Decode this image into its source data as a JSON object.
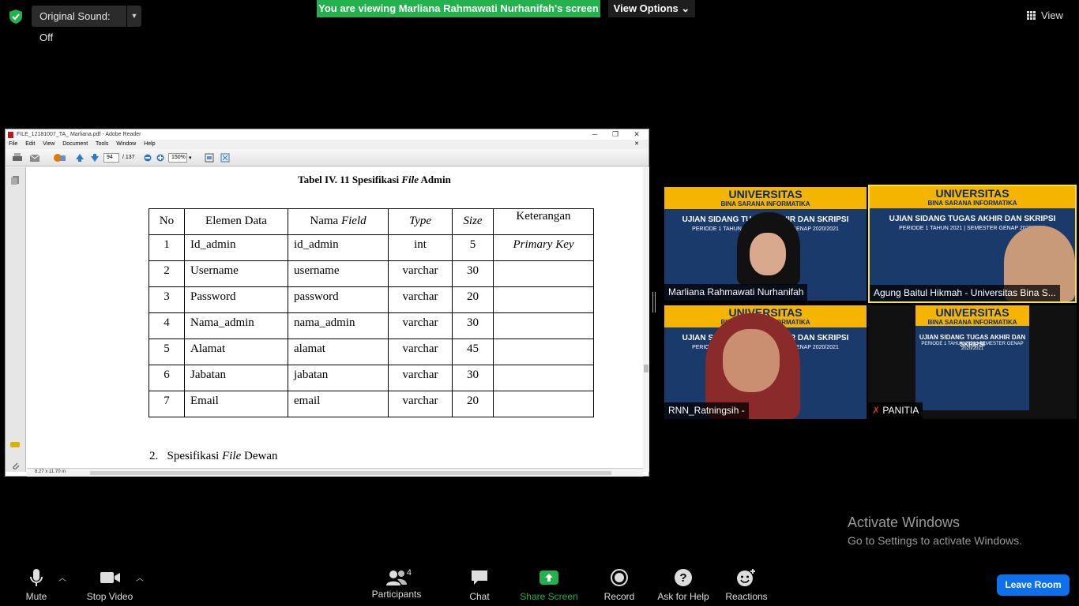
{
  "topbar": {
    "sound_label": "Original Sound: Off",
    "viewing_banner": "You are viewing Marliana Rahmawati Nurhanifah's screen",
    "view_options_label": "View Options",
    "view_label": "View"
  },
  "reader": {
    "window_title": "FILE_12181007_TA_ Marliana.pdf - Adobe Reader",
    "menu": [
      "File",
      "Edit",
      "View",
      "Document",
      "Tools",
      "Window",
      "Help"
    ],
    "page_current": "94",
    "page_total": "/ 137",
    "zoom": "150%",
    "page_size": "8.27 x 11.70 in",
    "table_title_prefix": "Tabel IV. 11 Spesifikasi ",
    "table_title_em": "File",
    "table_title_suffix": " Admin",
    "headers": {
      "no": "No",
      "elemen": "Elemen Data",
      "nama_prefix": "Nama ",
      "nama_em": "Field",
      "type": "Type",
      "size": "Size",
      "keterangan": "Keterangan"
    },
    "rows": [
      {
        "no": "1",
        "elemen": "Id_admin",
        "field": "id_admin",
        "type": "int",
        "size": "5",
        "ket": "Primary Key"
      },
      {
        "no": "2",
        "elemen": "Username",
        "field": "username",
        "type": "varchar",
        "size": "30",
        "ket": ""
      },
      {
        "no": "3",
        "elemen": "Password",
        "field": "password",
        "type": "varchar",
        "size": "20",
        "ket": ""
      },
      {
        "no": "4",
        "elemen": "Nama_admin",
        "field": "nama_admin",
        "type": "varchar",
        "size": "30",
        "ket": ""
      },
      {
        "no": "5",
        "elemen": "Alamat",
        "field": "alamat",
        "type": "varchar",
        "size": "45",
        "ket": ""
      },
      {
        "no": "6",
        "elemen": "Jabatan",
        "field": "jabatan",
        "type": "varchar",
        "size": "30",
        "ket": ""
      },
      {
        "no": "7",
        "elemen": "Email",
        "field": "email",
        "type": "varchar",
        "size": "20",
        "ket": ""
      }
    ],
    "section_number": "2.",
    "section_prefix": "Spesifikasi ",
    "section_em": "File",
    "section_suffix": " Dewan"
  },
  "videos": {
    "banner_title": "UNIVERSITAS",
    "banner_subtitle": "BINA SARANA INFORMATIKA",
    "event_title": "UJIAN SIDANG TUGAS AKHIR DAN SKRIPSI",
    "event_period": "PERIODE 1 TAHUN 2021 | SEMESTER GENAP 2020/2021",
    "participants": [
      {
        "name": "Marliana Rahmawati Nurhanifah"
      },
      {
        "name": "Agung Baitul Hikmah - Universitas Bina S..."
      },
      {
        "name": "RNN_Ratningsih -"
      },
      {
        "name": "PANITIA"
      }
    ]
  },
  "activate": {
    "title": "Activate Windows",
    "subtitle": "Go to Settings to activate Windows."
  },
  "bottombar": {
    "mute": "Mute",
    "stop_video": "Stop Video",
    "participants": "Participants",
    "participants_count": "4",
    "chat": "Chat",
    "share_screen": "Share Screen",
    "record": "Record",
    "ask_for_help": "Ask for Help",
    "reactions": "Reactions",
    "leave_room": "Leave Room"
  },
  "colors": {
    "share_green": "#22b14c",
    "leave_blue": "#0e71eb",
    "active_speaker": "#f4e042",
    "banner_yellow": "#f4b400",
    "banner_blue": "#1a3a6b"
  }
}
